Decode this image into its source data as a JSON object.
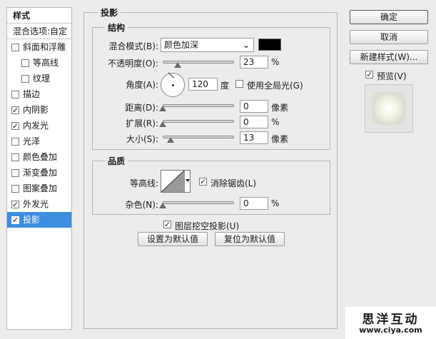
{
  "styles_panel": {
    "title": "样式",
    "blend_options": "混合选项:自定",
    "items": [
      {
        "label": "斜面和浮雕",
        "checked": false,
        "indent": false
      },
      {
        "label": "等高线",
        "checked": false,
        "indent": true
      },
      {
        "label": "纹理",
        "checked": false,
        "indent": true
      },
      {
        "label": "描边",
        "checked": false,
        "indent": false
      },
      {
        "label": "内阴影",
        "checked": true,
        "indent": false
      },
      {
        "label": "内发光",
        "checked": true,
        "indent": false
      },
      {
        "label": "光泽",
        "checked": false,
        "indent": false
      },
      {
        "label": "颜色叠加",
        "checked": false,
        "indent": false
      },
      {
        "label": "渐变叠加",
        "checked": false,
        "indent": false
      },
      {
        "label": "图案叠加",
        "checked": false,
        "indent": false
      },
      {
        "label": "外发光",
        "checked": true,
        "indent": false
      },
      {
        "label": "投影",
        "checked": true,
        "indent": false,
        "selected": true
      }
    ]
  },
  "section_title": "投影",
  "structure": {
    "legend": "结构",
    "blend_mode_label": "混合模式(B):",
    "blend_mode_value": "颜色加深",
    "shadow_color": "#000000",
    "opacity_label": "不透明度(O):",
    "opacity_value": "23",
    "opacity_unit": "%",
    "angle_label": "角度(A):",
    "angle_value": "120",
    "angle_unit": "度",
    "global_light_label": "使用全局光(G)",
    "distance_label": "距离(D):",
    "distance_value": "0",
    "distance_unit": "像素",
    "spread_label": "扩展(R):",
    "spread_value": "0",
    "spread_unit": "%",
    "size_label": "大小(S):",
    "size_value": "13",
    "size_unit": "像素"
  },
  "quality": {
    "legend": "品质",
    "contour_label": "等高线:",
    "anti_alias_label": "消除锯齿(L)",
    "noise_label": "杂色(N):",
    "noise_value": "0",
    "noise_unit": "%"
  },
  "knockout_label": "图层挖空投影(U)",
  "set_default_label": "设置为默认值",
  "reset_default_label": "复位为默认值",
  "right": {
    "ok_label": "确定",
    "cancel_label": "取消",
    "new_style_label": "新建样式(W)...",
    "preview_label": "预览(V)"
  },
  "watermark": {
    "title": "思洋互动",
    "url": "www.ciya.com"
  }
}
